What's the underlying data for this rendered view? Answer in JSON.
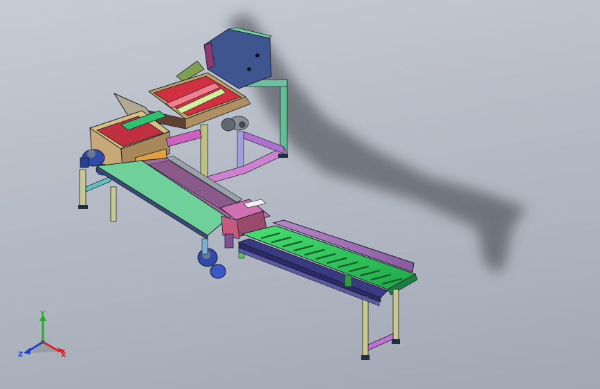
{
  "viewport": {
    "background_top": "#c6cbd4",
    "background_bottom": "#a1a8b4"
  },
  "triad": {
    "x_label": "X",
    "y_label": "Y",
    "z_label": "Z",
    "x_color": "#e02020",
    "y_color": "#20b020",
    "z_color": "#2040d0"
  },
  "model": {
    "frame_color": "#6fd08a",
    "belt_color": "#2fd060",
    "hopper_color": "#405080",
    "roller_color": "#e03040",
    "slider_color": "#c070c0",
    "motor_color": "#3050c0"
  }
}
